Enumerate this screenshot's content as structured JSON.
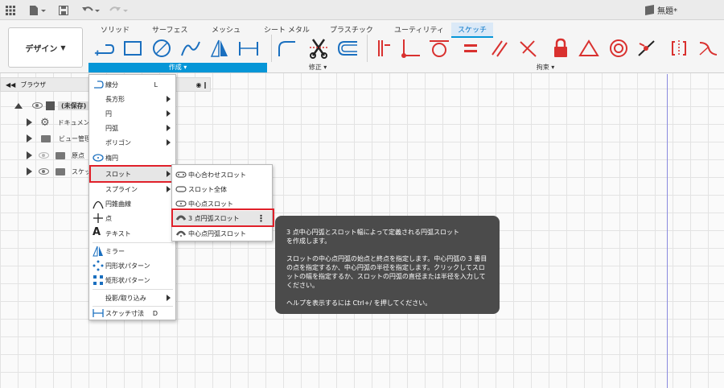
{
  "titlebar": {
    "doc_title": "無題*"
  },
  "ribbon": {
    "workspace_label": "デザイン",
    "tabs": [
      "ソリッド",
      "サーフェス",
      "メッシュ",
      "シート メタル",
      "プラスチック",
      "ユーティリティ",
      "スケッチ"
    ],
    "groups": {
      "create": "作成 ▾",
      "modify": "修正 ▾",
      "constraints": "拘束 ▾"
    }
  },
  "browser": {
    "title": "ブラウザ",
    "items": [
      {
        "label": "(未保存)"
      },
      {
        "label": "ドキュメン"
      },
      {
        "label": "ビュー管理"
      },
      {
        "label": "原点"
      },
      {
        "label": "スケッ"
      }
    ]
  },
  "create_menu": {
    "items": [
      {
        "label": "線分",
        "shortcut": "L"
      },
      {
        "label": "長方形"
      },
      {
        "label": "円"
      },
      {
        "label": "円弧"
      },
      {
        "label": "ポリゴン"
      },
      {
        "label": "楕円"
      },
      {
        "label": "スロット"
      },
      {
        "label": "スプライン"
      },
      {
        "label": "円錐曲線"
      },
      {
        "label": "点"
      },
      {
        "label": "テキスト"
      },
      {
        "label": "ミラー"
      },
      {
        "label": "円形状パターン"
      },
      {
        "label": "矩形状パターン"
      },
      {
        "label": "投影/取り込み"
      },
      {
        "label": "スケッチ寸法",
        "shortcut": "D"
      }
    ]
  },
  "slot_submenu": {
    "items": [
      {
        "label": "中心合わせスロット"
      },
      {
        "label": "スロット全体"
      },
      {
        "label": "中心点スロット"
      },
      {
        "label": "3 点円弧スロット"
      },
      {
        "label": "中心点円弧スロット"
      }
    ]
  },
  "tooltip": {
    "line1": "3 点中心円弧とスロット幅によって定義される円弧スロット",
    "line1b": "を作成します。",
    "para2": "スロットの中心点円弧の始点と終点を指定します。中心円弧の 3 番目の点を指定するか、中心円弧の半径を指定します。クリックしてスロットの幅を指定するか、スロットの円弧の直径または半径を入力してください。",
    "para3": "ヘルプを表示するには Ctrl+/ を押してください。"
  },
  "colors": {
    "accent": "#0696d7",
    "sketch_icon_blue": "#1a6fbf",
    "constraint_red": "#d9312f",
    "highlight_red": "#e0202a",
    "tooltip_bg": "#4b4b4b"
  }
}
